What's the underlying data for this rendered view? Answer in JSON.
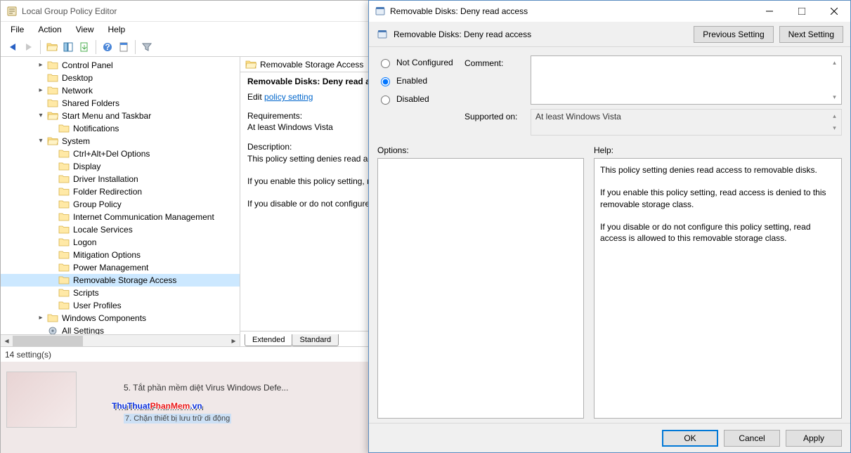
{
  "main": {
    "title": "Local Group Policy Editor",
    "menu": {
      "file": "File",
      "action": "Action",
      "view": "View",
      "help": "Help"
    },
    "status": "14 setting(s)"
  },
  "tree": {
    "items": [
      {
        "depth": 3,
        "expander": "▸",
        "label": "Control Panel"
      },
      {
        "depth": 3,
        "expander": "",
        "label": "Desktop"
      },
      {
        "depth": 3,
        "expander": "▸",
        "label": "Network"
      },
      {
        "depth": 3,
        "expander": "",
        "label": "Shared Folders"
      },
      {
        "depth": 3,
        "expander": "▾",
        "label": "Start Menu and Taskbar"
      },
      {
        "depth": 4,
        "expander": "",
        "label": "Notifications"
      },
      {
        "depth": 3,
        "expander": "▾",
        "label": "System"
      },
      {
        "depth": 4,
        "expander": "",
        "label": "Ctrl+Alt+Del Options"
      },
      {
        "depth": 4,
        "expander": "",
        "label": "Display"
      },
      {
        "depth": 4,
        "expander": "",
        "label": "Driver Installation"
      },
      {
        "depth": 4,
        "expander": "",
        "label": "Folder Redirection"
      },
      {
        "depth": 4,
        "expander": "",
        "label": "Group Policy"
      },
      {
        "depth": 4,
        "expander": "",
        "label": "Internet Communication Management"
      },
      {
        "depth": 4,
        "expander": "",
        "label": "Locale Services"
      },
      {
        "depth": 4,
        "expander": "",
        "label": "Logon"
      },
      {
        "depth": 4,
        "expander": "",
        "label": "Mitigation Options"
      },
      {
        "depth": 4,
        "expander": "",
        "label": "Power Management"
      },
      {
        "depth": 4,
        "expander": "",
        "label": "Removable Storage Access",
        "selected": true
      },
      {
        "depth": 4,
        "expander": "",
        "label": "Scripts"
      },
      {
        "depth": 4,
        "expander": "",
        "label": "User Profiles"
      },
      {
        "depth": 3,
        "expander": "▸",
        "label": "Windows Components"
      },
      {
        "depth": 3,
        "expander": "",
        "label": "All Settings",
        "special": true
      }
    ]
  },
  "right": {
    "header": "Removable Storage Access",
    "setting_title": "Removable Disks: Deny read access",
    "edit_prefix": "Edit ",
    "edit_link": "policy setting",
    "req_head": "Requirements:",
    "req_text": "At least Windows Vista",
    "desc_head": "Description:",
    "desc_p1": "This policy setting denies read access to removable disks.",
    "desc_p2": "If you enable this policy setting, read access is denied to this removable storage class.",
    "desc_p3": "If you disable or do not configure this policy setting, read access is allowed to this removable storage class.",
    "tab_extended": "Extended",
    "tab_standard": "Standard"
  },
  "bg": {
    "line1": "5. Tắt phần mềm diệt Virus Windows Defe...",
    "logo_a": "ThuThuat",
    "logo_b": "PhanMem",
    "logo_c": ".vn",
    "line2": "7. Chặn thiết bị lưu trữ di động"
  },
  "dlg": {
    "title": "Removable Disks: Deny read access",
    "head": "Removable Disks: Deny read access",
    "prev": "Previous Setting",
    "next": "Next Setting",
    "opt_nc": "Not Configured",
    "opt_en": "Enabled",
    "opt_di": "Disabled",
    "comment_lbl": "Comment:",
    "supported_lbl": "Supported on:",
    "supported_val": "At least Windows Vista",
    "options_lbl": "Options:",
    "help_lbl": "Help:",
    "help_p1": "This policy setting denies read access to removable disks.",
    "help_p2": "If you enable this policy setting, read access is denied to this removable storage class.",
    "help_p3": "If you disable or do not configure this policy setting, read access is allowed to this removable storage class.",
    "ok": "OK",
    "cancel": "Cancel",
    "apply": "Apply"
  }
}
